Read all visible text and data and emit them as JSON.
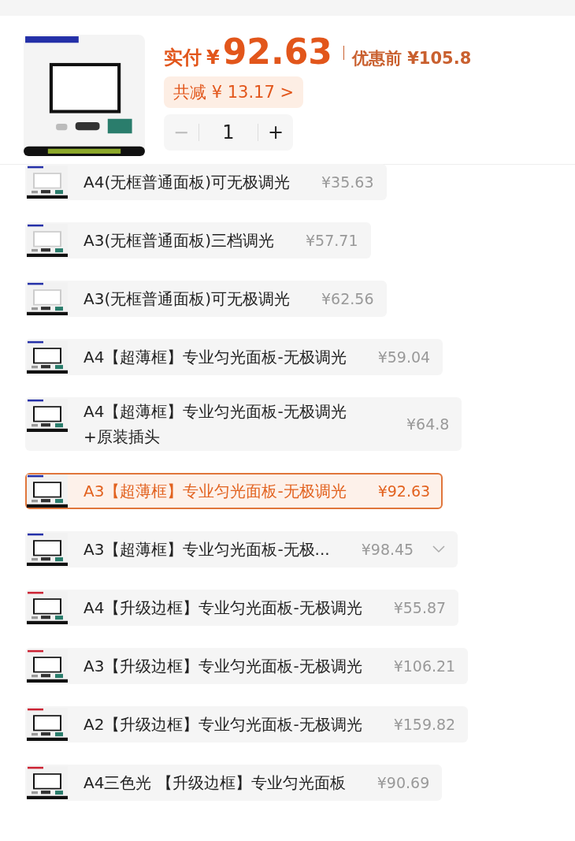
{
  "header": {
    "paid_label": "实付",
    "paid_currency": "¥",
    "paid_amount": "92.63",
    "original_label": "优惠前",
    "original_price": "¥105.8",
    "discount_label": "共减",
    "discount_amount": "¥ 13.17",
    "discount_chevron": ">",
    "quantity": {
      "minus": "−",
      "value": "1",
      "plus": "+",
      "minus_disabled": true
    }
  },
  "options": [
    {
      "name": "A4(无框普通面板)可无极调光",
      "price": "¥35.63",
      "selected": false,
      "expandable": false
    },
    {
      "name": "A3(无框普通面板)三档调光",
      "price": "¥57.71",
      "selected": false,
      "expandable": false
    },
    {
      "name": "A3(无框普通面板)可无极调光",
      "price": "¥62.56",
      "selected": false,
      "expandable": false
    },
    {
      "name": "A4【超薄框】专业匀光面板-无极调光",
      "price": "¥59.04",
      "selected": false,
      "expandable": false
    },
    {
      "name": "A4【超薄框】专业匀光面板-无极调光+原装插头",
      "price": "¥64.8",
      "selected": false,
      "expandable": false
    },
    {
      "name": "A3【超薄框】专业匀光面板-无极调光",
      "price": "¥92.63",
      "selected": true,
      "expandable": false
    },
    {
      "name": "A3【超薄框】专业匀光面板-无极...",
      "price": "¥98.45",
      "selected": false,
      "expandable": true
    },
    {
      "name": "A4【升级边框】专业匀光面板-无极调光",
      "price": "¥55.87",
      "selected": false,
      "expandable": false
    },
    {
      "name": "A3【升级边框】专业匀光面板-无极调光",
      "price": "¥106.21",
      "selected": false,
      "expandable": false
    },
    {
      "name": "A2【升级边框】专业匀光面板-无极调光",
      "price": "¥159.82",
      "selected": false,
      "expandable": false
    },
    {
      "name": "A4三色光 【升级边框】专业匀光面板",
      "price": "¥90.69",
      "selected": false,
      "expandable": false
    }
  ]
}
